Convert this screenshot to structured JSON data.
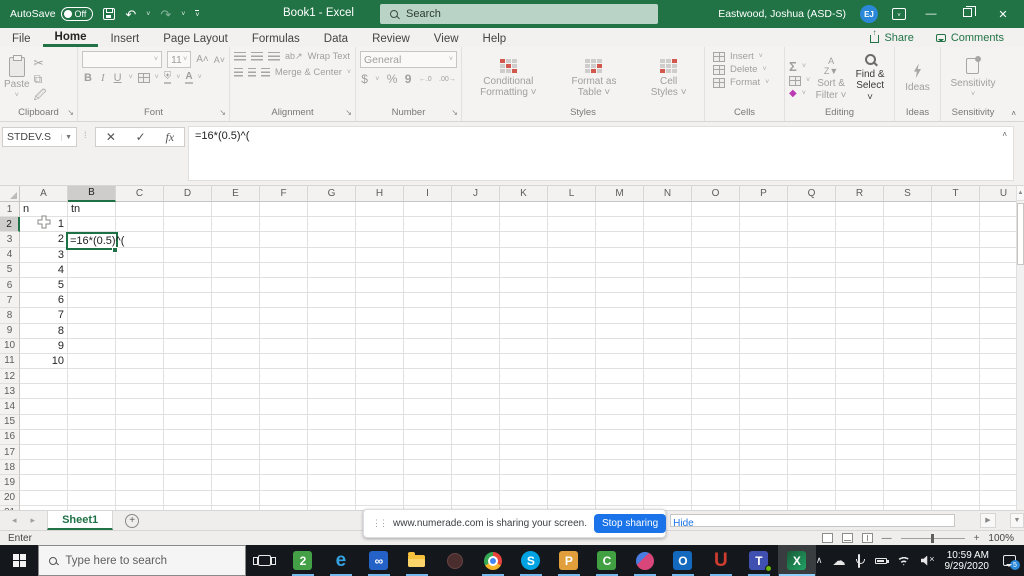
{
  "colors": {
    "accent_green": "#217346",
    "stop_sharing_blue": "#1a73e8",
    "taskbar_open_indicator": "#76b9ed"
  },
  "titlebar": {
    "autosave_label": "AutoSave",
    "autosave_state": "Off",
    "window_title": "Book1 - Excel",
    "search_placeholder": "Search",
    "user_name": "Eastwood, Joshua (ASD-S)",
    "user_initials": "EJ"
  },
  "ribbon": {
    "tabs": [
      {
        "label": "File",
        "active": false
      },
      {
        "label": "Home",
        "active": true
      },
      {
        "label": "Insert",
        "active": false
      },
      {
        "label": "Page Layout",
        "active": false
      },
      {
        "label": "Formulas",
        "active": false
      },
      {
        "label": "Data",
        "active": false
      },
      {
        "label": "Review",
        "active": false
      },
      {
        "label": "View",
        "active": false
      },
      {
        "label": "Help",
        "active": false
      }
    ],
    "share_label": "Share",
    "comments_label": "Comments",
    "clipboard": {
      "group_label": "Clipboard",
      "paste_label": "Paste"
    },
    "font": {
      "group_label": "Font",
      "font_size": "11",
      "bold": "B",
      "italic": "I",
      "underline": "U"
    },
    "alignment": {
      "group_label": "Alignment",
      "wrap_text": "Wrap Text",
      "merge_center": "Merge & Center"
    },
    "number": {
      "group_label": "Number",
      "number_format": "General",
      "currency": "$",
      "percent": "%",
      "comma": "9"
    },
    "styles": {
      "group_label": "Styles",
      "conditional": "Conditional Formatting ˅",
      "format_table": "Format as Table ˅",
      "cell_styles": "Cell Styles ˅"
    },
    "cells": {
      "group_label": "Cells",
      "insert": "Insert",
      "delete": "Delete",
      "format": "Format"
    },
    "editing": {
      "group_label": "Editing",
      "sort_filter": "Sort & Filter ˅",
      "find_select": "Find & Select ˅"
    },
    "ideas": {
      "group_label": "Ideas",
      "ideas_label": "Ideas"
    },
    "sensitivity": {
      "group_label": "Sensitivity",
      "sensitivity_label": "Sensitivity"
    }
  },
  "formula_bar": {
    "name_box": "STDEV.S",
    "formula": "=16*(0.5)^("
  },
  "grid": {
    "columns": [
      "A",
      "B",
      "C",
      "D",
      "E",
      "F",
      "G",
      "H",
      "I",
      "J",
      "K",
      "L",
      "M",
      "N",
      "O",
      "P",
      "Q",
      "R",
      "S",
      "T",
      "U"
    ],
    "row_count": 21,
    "selected_column": "B",
    "selected_row": 2,
    "editing_cell": "B2",
    "cells": {
      "A1": "n",
      "B1": "tn",
      "A2": "1",
      "A3": "2",
      "A4": "3",
      "A5": "4",
      "A6": "5",
      "A7": "6",
      "A8": "7",
      "A9": "8",
      "A10": "9",
      "A11": "10",
      "B2": "=16*(0.5)^("
    },
    "right_aligned": [
      "A2",
      "A3",
      "A4",
      "A5",
      "A6",
      "A7",
      "A8",
      "A9",
      "A10",
      "A11"
    ]
  },
  "sheet_bar": {
    "sheet_name": "Sheet1"
  },
  "share_banner": {
    "message": "www.numerade.com is sharing your screen.",
    "stop_button": "Stop sharing",
    "hide_link": "Hide"
  },
  "status_bar": {
    "mode": "Enter",
    "zoom_level": "100%"
  },
  "taskbar": {
    "search_placeholder": "Type here to search",
    "apps": [
      {
        "name": "task-view-icon",
        "kind": "taskview",
        "open": false,
        "active": false
      },
      {
        "name": "app-2-icon",
        "kind": "glyph",
        "glyph": "2",
        "bg": "#43a047",
        "fg": "#ffffff",
        "open": true,
        "active": false
      },
      {
        "name": "edge-icon",
        "kind": "glyph",
        "glyph": "e",
        "bg": "transparent",
        "fg": "#35a2e0",
        "big": true,
        "open": true,
        "active": false
      },
      {
        "name": "infinity-app-icon",
        "kind": "glyph",
        "glyph": "∞",
        "bg": "#2562c8",
        "fg": "#ffffff",
        "open": true,
        "active": false
      },
      {
        "name": "file-explorer-icon",
        "kind": "folder",
        "open": true,
        "active": false
      },
      {
        "name": "muted-app-icon",
        "kind": "muted",
        "open": false,
        "active": false
      },
      {
        "name": "chrome-icon",
        "kind": "chrome",
        "open": true,
        "active": false
      },
      {
        "name": "skype-icon",
        "kind": "glyph",
        "glyph": "S",
        "bg": "#00a3e2",
        "fg": "#ffffff",
        "round": true,
        "open": true,
        "active": false
      },
      {
        "name": "app-p-icon",
        "kind": "glyph",
        "glyph": "P",
        "bg": "#e09f3a",
        "fg": "#ffffff",
        "open": true,
        "active": false
      },
      {
        "name": "app-c-icon",
        "kind": "glyph",
        "glyph": "C",
        "bg": "#41a042",
        "fg": "#ffffff",
        "open": true,
        "active": false
      },
      {
        "name": "swirl-app-icon",
        "kind": "swirl",
        "open": true,
        "active": false
      },
      {
        "name": "outlook-icon",
        "kind": "glyph",
        "glyph": "O",
        "bg": "#1269bd",
        "fg": "#ffffff",
        "open": true,
        "active": false
      },
      {
        "name": "app-u-icon",
        "kind": "glyph",
        "glyph": "U",
        "bg": "transparent",
        "fg": "#d03c30",
        "big": true,
        "open": true,
        "active": false
      },
      {
        "name": "teams-icon",
        "kind": "glyph",
        "glyph": "T",
        "bg": "#4050b0",
        "fg": "#ffffff",
        "badge": true,
        "open": true,
        "active": false
      },
      {
        "name": "excel-icon",
        "kind": "glyph",
        "glyph": "X",
        "bg": "xl",
        "fg": "#ffffff",
        "open": true,
        "active": true
      }
    ],
    "clock_time": "10:59 AM",
    "clock_date": "9/29/2020",
    "notification_count": "5"
  }
}
